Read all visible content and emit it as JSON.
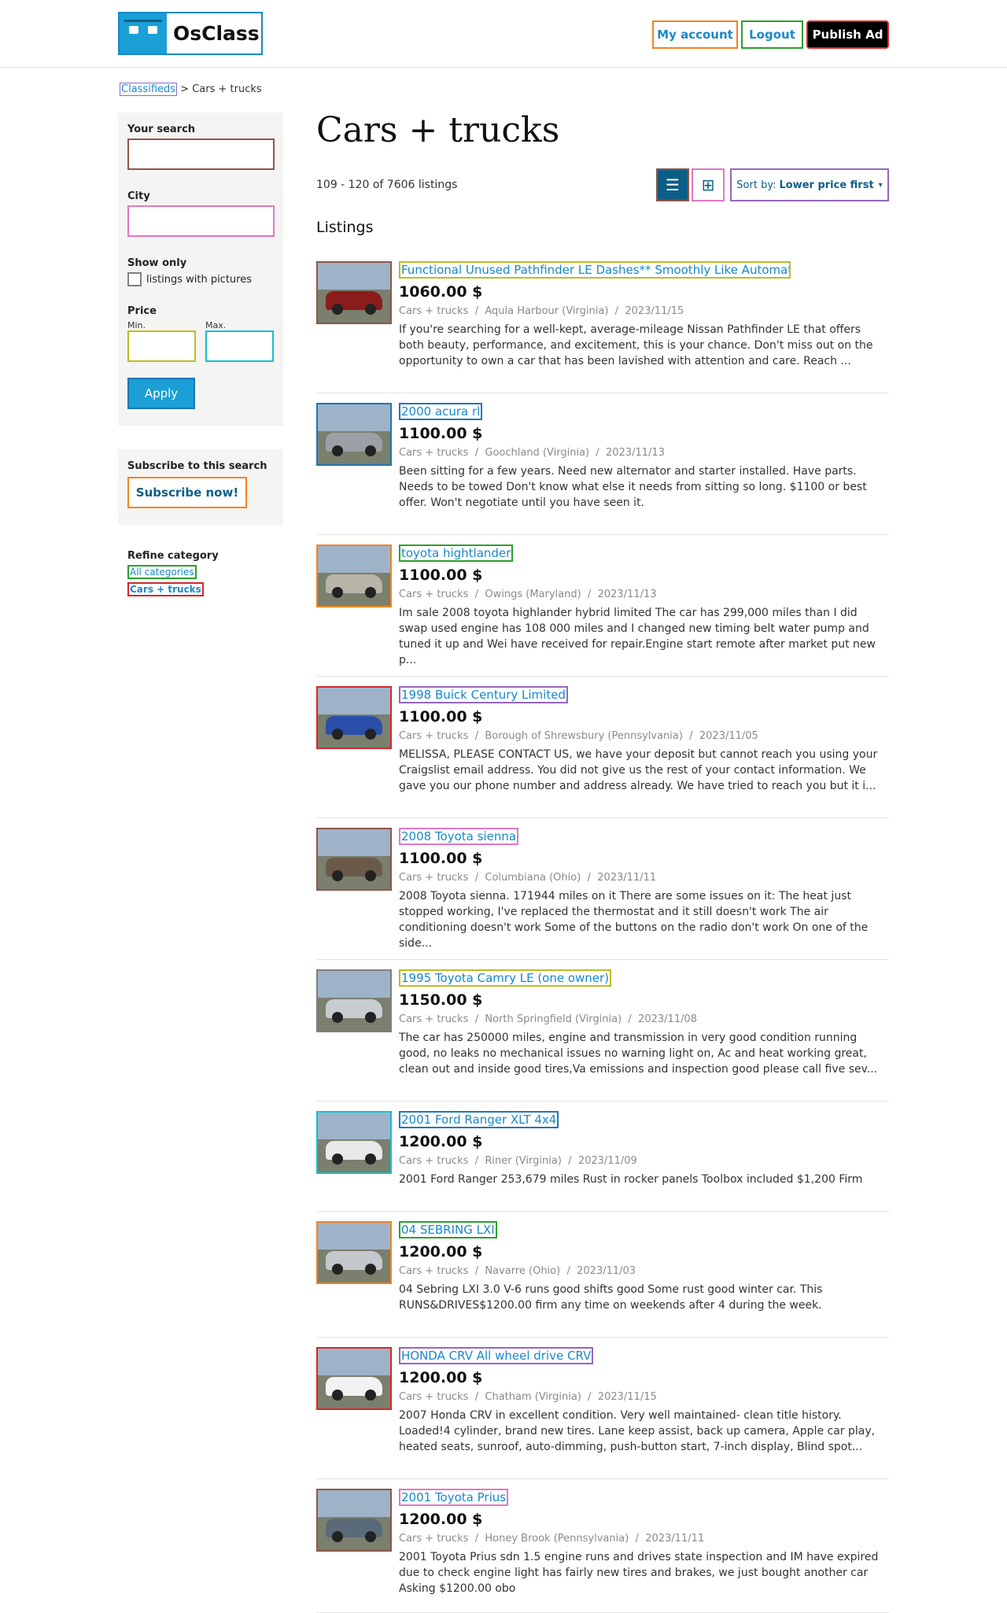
{
  "header": {
    "logo_text": "OsClass",
    "my_account": "My account",
    "logout": "Logout",
    "publish": "Publish Ad"
  },
  "breadcrumb": {
    "root": "Classifieds",
    "sep": ">",
    "current": "Cars + trucks"
  },
  "sidebar": {
    "your_search": "Your search",
    "city": "City",
    "show_only": "Show only",
    "with_pictures": "listings with pictures",
    "price": "Price",
    "min": "Min.",
    "max": "Max.",
    "apply": "Apply",
    "subscribe_title": "Subscribe to this search",
    "subscribe_btn": "Subscribe now!",
    "refine_title": "Refine category",
    "all_categories": "All categories",
    "current_category": "Cars + trucks"
  },
  "main": {
    "title": "Cars + trucks",
    "count": "109 - 120 of 7606 listings",
    "sort_prefix": "Sort by:",
    "sort_value": "Lower price first",
    "listings_heading": "Listings"
  },
  "listings": [
    {
      "title": "Functional Unused Pathfinder LE Dashes** Smoothly Like Automatic",
      "price": "1060.00 $",
      "category": "Cars + trucks",
      "location": "Aquia Harbour (Virginia)",
      "date": "2023/11/15",
      "desc": "If you're searching for a well-kept, average-mileage Nissan Pathfinder LE that offers both beauty, performance, and excitement, this is your chance. Don't miss out on the opportunity to own a car that has been lavished with attention and care. Reach ...",
      "car_color": "#8b1c1c"
    },
    {
      "title": "2000 acura rl",
      "price": "1100.00 $",
      "category": "Cars + trucks",
      "location": "Goochland (Virginia)",
      "date": "2023/11/13",
      "desc": "Been sitting for a few years. Need new alternator and starter installed. Have parts. Needs to be towed Don't know what else it needs from sitting so long. $1100 or best offer. Won't negotiate until you have seen it.",
      "car_color": "#9aa0a6"
    },
    {
      "title": "toyota hightlander",
      "price": "1100.00 $",
      "category": "Cars + trucks",
      "location": "Owings (Maryland)",
      "date": "2023/11/13",
      "desc": "Im sale 2008 toyota highlander hybrid limited The car has 299,000 miles than I did swap used engine has 108 000 miles and I changed new timing belt water pump and tuned it up and Wei have received for repair.Engine start remote after market put new p...",
      "car_color": "#b9b4a8"
    },
    {
      "title": "1998 Buick Century Limited",
      "price": "1100.00 $",
      "category": "Cars + trucks",
      "location": "Borough of Shrewsbury (Pennsylvania)",
      "date": "2023/11/05",
      "desc": "MELISSA, PLEASE CONTACT US, we have your deposit but cannot reach you using your Craigslist email address. You did not give us the rest of your contact information. We gave you our phone number and address already. We have tried to reach you but it i...",
      "car_color": "#2b4fa8"
    },
    {
      "title": "2008 Toyota sienna",
      "price": "1100.00 $",
      "category": "Cars + trucks",
      "location": "Columbiana (Ohio)",
      "date": "2023/11/11",
      "desc": "2008 Toyota sienna. 171944 miles on it There are some issues on it: The heat just stopped working, I've replaced the thermostat and it still doesn't work The air conditioning doesn't work Some of the buttons on the radio don't work On one of the side...",
      "car_color": "#6b5a4a"
    },
    {
      "title": "1995 Toyota Camry LE (one owner)",
      "price": "1150.00 $",
      "category": "Cars + trucks",
      "location": "North Springfield (Virginia)",
      "date": "2023/11/08",
      "desc": "The car has 250000 miles, engine and transmission in very good condition running good, no leaks no mechanical issues no warning light on, Ac and heat working great, clean out and inside good tires,Va emissions and inspection good please call five sev...",
      "car_color": "#c9ccd1"
    },
    {
      "title": "2001 Ford Ranger XLT 4x4",
      "price": "1200.00 $",
      "category": "Cars + trucks",
      "location": "Riner (Virginia)",
      "date": "2023/11/09",
      "desc": "2001 Ford Ranger 253,679 miles Rust in rocker panels Toolbox included $1,200 Firm",
      "car_color": "#e8e8e8"
    },
    {
      "title": "04 SEBRING LXI",
      "price": "1200.00 $",
      "category": "Cars + trucks",
      "location": "Navarre (Ohio)",
      "date": "2023/11/03",
      "desc": "04 Sebring LXI 3.0 V-6 runs good shifts good Some rust good winter car. This RUNS&DRIVES$1200.00 firm any time on weekends after 4 during the week.",
      "car_color": "#c4c8cc"
    },
    {
      "title": "HONDA CRV All wheel drive CRV",
      "price": "1200.00 $",
      "category": "Cars + trucks",
      "location": "Chatham (Virginia)",
      "date": "2023/11/15",
      "desc": "2007 Honda CRV in excellent condition. Very well maintained- clean title history. Loaded!4 cylinder, brand new tires. Lane keep assist, back up camera, Apple car play, heated seats, sunroof, auto-dimming, push-button start, 7-inch display, Blind spot...",
      "car_color": "#f2f2f2"
    },
    {
      "title": "2001 Toyota Prius",
      "price": "1200.00 $",
      "category": "Cars + trucks",
      "location": "Honey Brook (Pennsylvania)",
      "date": "2023/11/11",
      "desc": "2001 Toyota Prius sdn 1.5 engine runs and drives state inspection and IM have expired due to check engine light has fairly new tires and brakes, we just bought another car Asking $1200.00 obo",
      "car_color": "#5a6a78"
    }
  ]
}
